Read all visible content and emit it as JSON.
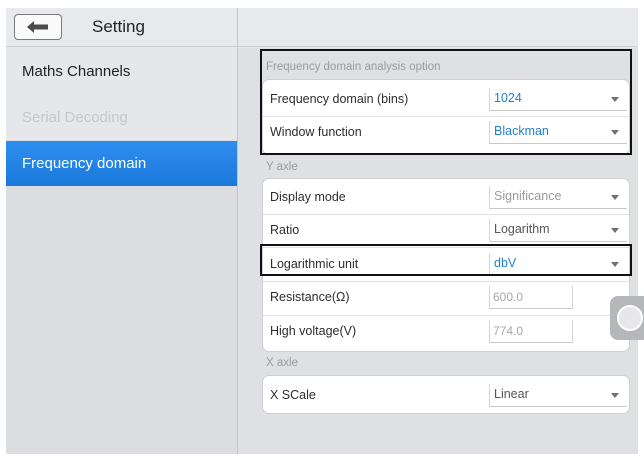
{
  "header": {
    "title": "Setting"
  },
  "sidebar": {
    "items": [
      {
        "label": "Maths Channels"
      },
      {
        "label": "Serial Decoding"
      },
      {
        "label": "Frequency domain"
      }
    ]
  },
  "freq_section": {
    "title": "Frequency domain analysis option",
    "bins_label": "Frequency domain (bins)",
    "bins_value": "1024",
    "window_label": "Window function",
    "window_value": "Blackman"
  },
  "y_section": {
    "title": "Y axle",
    "display_mode_label": "Display mode",
    "display_mode_value": "Significance",
    "ratio_label": "Ratio",
    "ratio_value": "Logarithm",
    "log_unit_label": "Logarithmic unit",
    "log_unit_value": "dbV",
    "resistance_label": "Resistance(Ω)",
    "resistance_value": "600.0",
    "high_voltage_label": "High voltage(V)",
    "high_voltage_value": "774.0"
  },
  "x_section": {
    "title": "X axle",
    "scale_label": "X SCale",
    "scale_value": "Linear"
  },
  "colors": {
    "accent": "#1f7fd0",
    "selected_bg": "#2a88ec",
    "disabled_text": "#c6c7ca"
  },
  "icons": {
    "back": "back-arrow-icon",
    "dropdown": "chevron-down-icon",
    "floating": "assistive-touch-icon"
  }
}
